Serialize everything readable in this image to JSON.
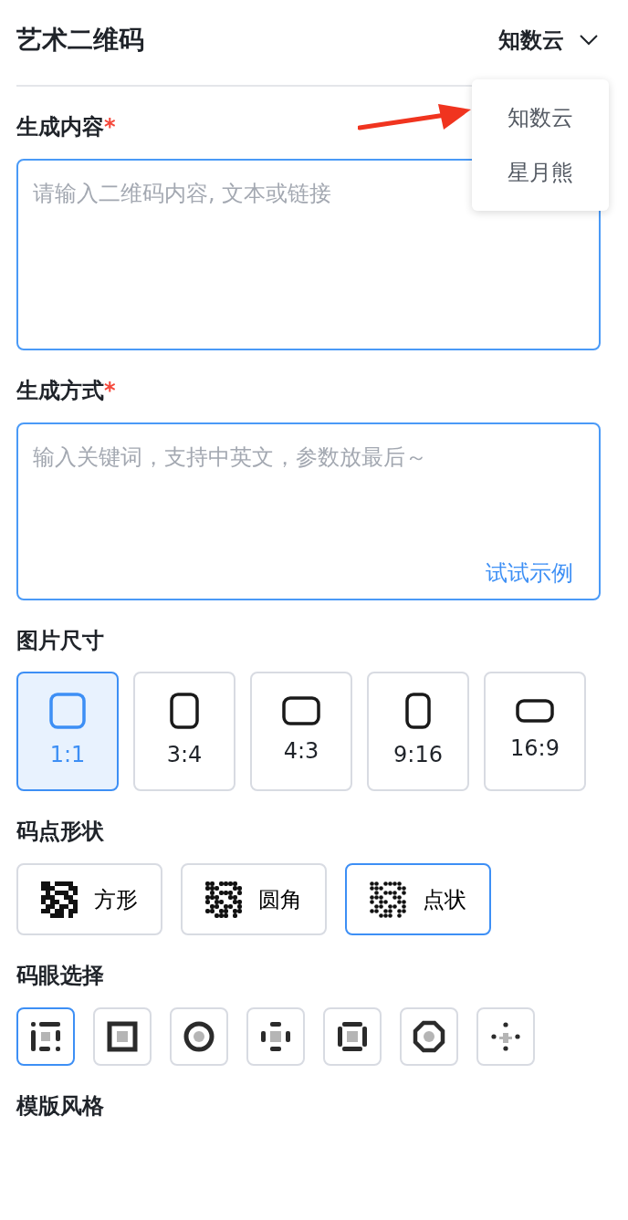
{
  "header": {
    "title": "艺术二维码",
    "provider": "知数云"
  },
  "provider_menu": {
    "items": [
      {
        "label": "知数云"
      },
      {
        "label": "星月熊"
      }
    ]
  },
  "content": {
    "label": "生成内容",
    "required_mark": "*",
    "placeholder": "请输入二维码内容, 文本或链接"
  },
  "method": {
    "label": "生成方式",
    "required_mark": "*",
    "placeholder": "输入关键词，支持中英文，参数放最后～",
    "example_link": "试试示例"
  },
  "size": {
    "label": "图片尺寸",
    "options": [
      {
        "label": "1:1",
        "selected": true
      },
      {
        "label": "3:4",
        "selected": false
      },
      {
        "label": "4:3",
        "selected": false
      },
      {
        "label": "9:16",
        "selected": false
      },
      {
        "label": "16:9",
        "selected": false
      }
    ]
  },
  "dot_shape": {
    "label": "码点形状",
    "options": [
      {
        "label": "方形",
        "selected": false
      },
      {
        "label": "圆角",
        "selected": false
      },
      {
        "label": "点状",
        "selected": true
      }
    ]
  },
  "eye": {
    "label": "码眼选择",
    "options": [
      {
        "selected": true
      },
      {
        "selected": false
      },
      {
        "selected": false
      },
      {
        "selected": false
      },
      {
        "selected": false
      },
      {
        "selected": false
      },
      {
        "selected": false
      }
    ]
  },
  "template": {
    "label": "模版风格"
  }
}
